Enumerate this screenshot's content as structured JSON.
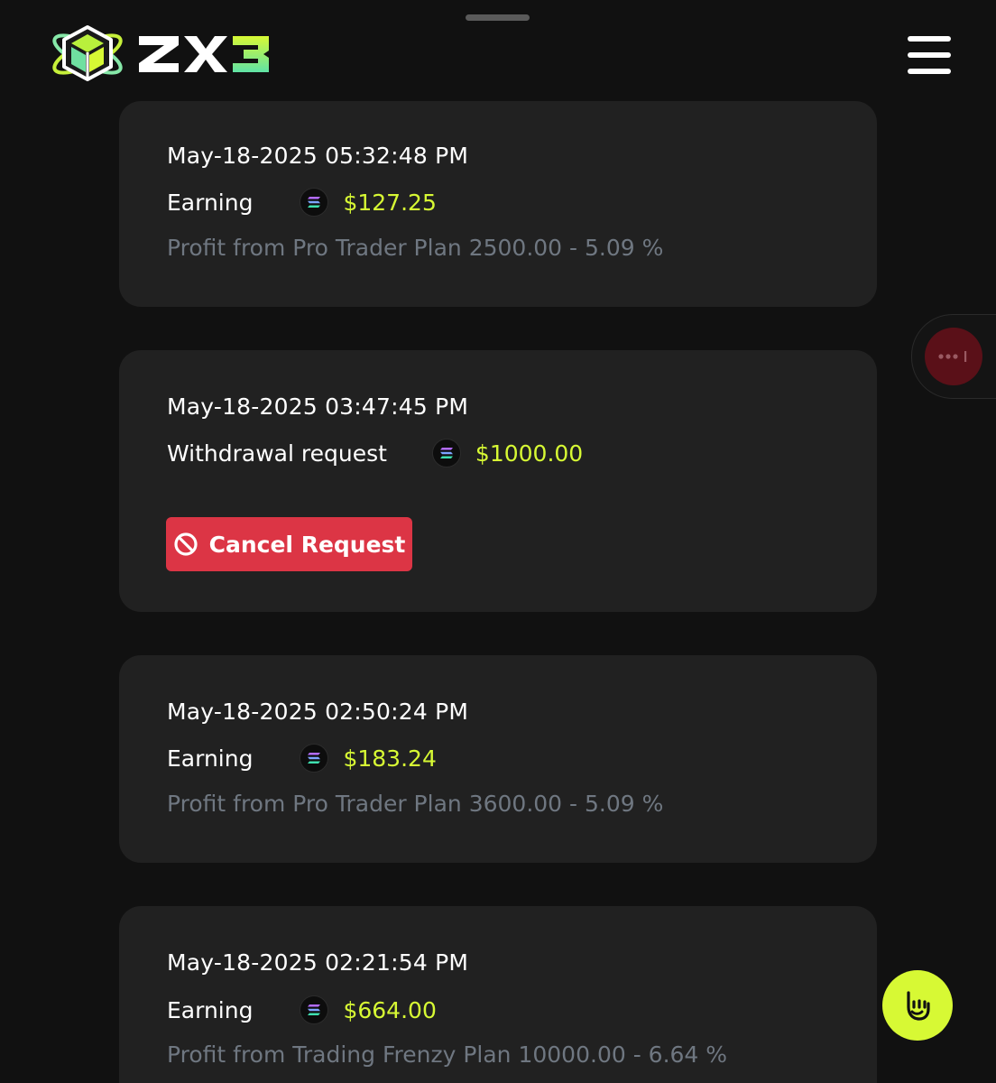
{
  "header": {
    "logo_text": "ZX3",
    "menu_icon": "hamburger-menu-icon"
  },
  "transactions": [
    {
      "date": "May-18-2025 05:32:48 PM",
      "type": "Earning",
      "coin_icon": "solana-icon",
      "amount": "$127.25",
      "description": "Profit from Pro Trader Plan 2500.00 - 5.09 %"
    },
    {
      "date": "May-18-2025 03:47:45 PM",
      "type": "Withdrawal request",
      "coin_icon": "solana-icon",
      "amount": "$1000.00",
      "action_label": "Cancel Request",
      "action_icon": "ban-icon"
    },
    {
      "date": "May-18-2025 02:50:24 PM",
      "type": "Earning",
      "coin_icon": "solana-icon",
      "amount": "$183.24",
      "description": "Profit from Pro Trader Plan 3600.00 - 5.09 %"
    },
    {
      "date": "May-18-2025 02:21:54 PM",
      "type": "Earning",
      "coin_icon": "solana-icon",
      "amount": "$664.00",
      "description": "Profit from Trading Frenzy Plan 10000.00 - 6.64 %"
    }
  ],
  "floating": {
    "side_icon": "more-dots-icon",
    "help_icon": "hand-gesture-icon"
  },
  "colors": {
    "background": "#111111",
    "card": "#212121",
    "accent_lime": "#d7f934",
    "danger": "#dc3545",
    "muted_text": "#6f7781"
  }
}
